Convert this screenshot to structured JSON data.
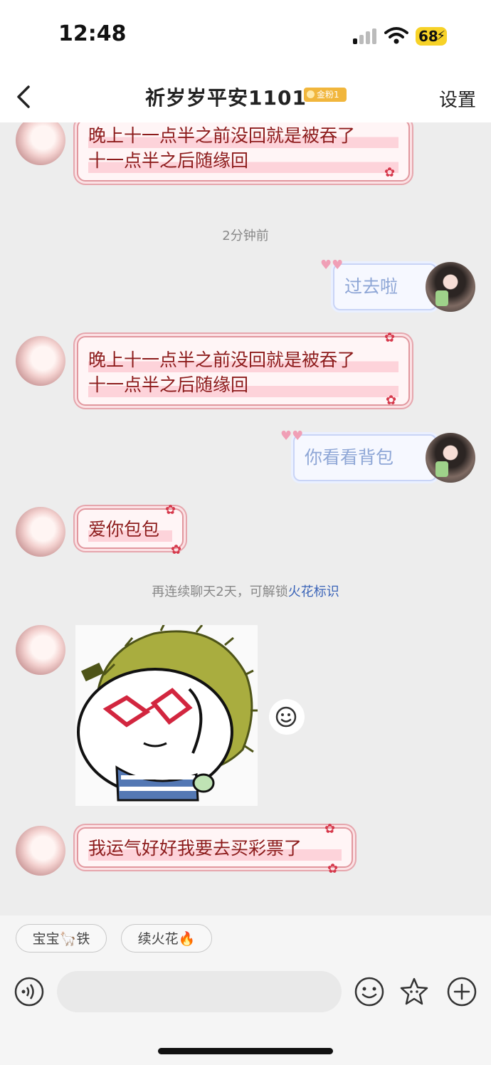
{
  "status_bar": {
    "time": "12:48",
    "battery": "68"
  },
  "header": {
    "title": "祈岁岁平安1101",
    "badge": "金粉1",
    "settings_label": "设置"
  },
  "messages": [
    {
      "side": "left",
      "lines": [
        "晚上十一点半之前没回就是被吞了",
        "十一点半之后随缘回"
      ]
    },
    {
      "side": "right",
      "lines": [
        "过去啦"
      ]
    },
    {
      "side": "left",
      "lines": [
        "晚上十一点半之前没回就是被吞了",
        "十一点半之后随缘回"
      ]
    },
    {
      "side": "right",
      "lines": [
        "你看看背包"
      ]
    },
    {
      "side": "left",
      "lines": [
        "爱你包包"
      ]
    },
    {
      "side": "left",
      "type": "sticker"
    },
    {
      "side": "left",
      "lines": [
        "我运气好好我要去买彩票了"
      ]
    }
  ],
  "time_label": "2分钟前",
  "system_notice": {
    "text": "再连续聊天2天，可解锁",
    "highlight": "火花标识"
  },
  "quick_replies": [
    "宝宝🦙铁",
    "续火花🔥"
  ],
  "input": {
    "placeholder": ""
  },
  "icons": [
    "back-icon",
    "voice-icon",
    "emoji-icon",
    "star-icon",
    "plus-icon",
    "sticker-smile-icon"
  ]
}
